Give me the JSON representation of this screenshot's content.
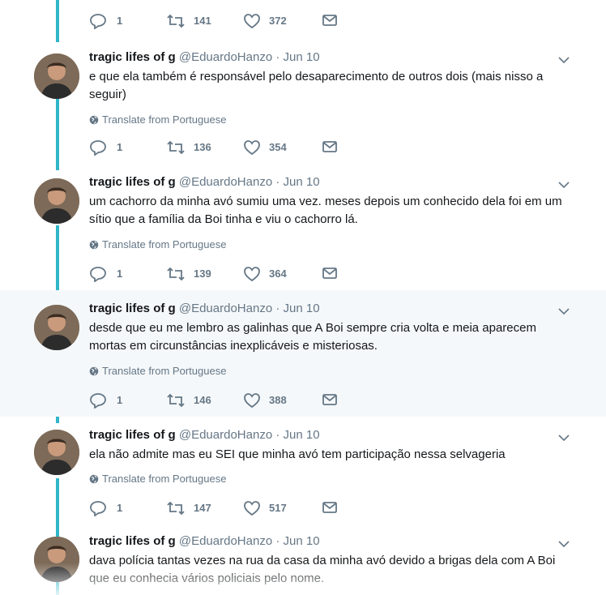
{
  "translate_label": "Translate from Portuguese",
  "accent_color": "#2fb6c9",
  "tweets": [
    {
      "replies": "1",
      "retweets": "141",
      "likes": "372"
    },
    {
      "name": "tragic lifes of g",
      "handle": "@EduardoHanzo",
      "sep": "·",
      "date": "Jun 10",
      "text": "e que ela também é responsável pelo desaparecimento de outros dois (mais nisso a seguir)",
      "replies": "1",
      "retweets": "136",
      "likes": "354"
    },
    {
      "name": "tragic lifes of g",
      "handle": "@EduardoHanzo",
      "sep": "·",
      "date": "Jun 10",
      "text": "um cachorro da minha avó sumiu uma vez. meses depois um conhecido dela foi em um sítio que a família da Boi tinha e viu o cachorro lá.",
      "replies": "1",
      "retweets": "139",
      "likes": "364"
    },
    {
      "name": "tragic lifes of g",
      "handle": "@EduardoHanzo",
      "sep": "·",
      "date": "Jun 10",
      "text": "desde que eu me lembro as galinhas que A Boi sempre cria volta e meia aparecem mortas em circunstâncias inexplicáveis e misteriosas.",
      "replies": "1",
      "retweets": "146",
      "likes": "388"
    },
    {
      "name": "tragic lifes of g",
      "handle": "@EduardoHanzo",
      "sep": "·",
      "date": "Jun 10",
      "text": "ela não admite mas eu SEI que minha avó tem participação nessa selvageria",
      "replies": "1",
      "retweets": "147",
      "likes": "517"
    },
    {
      "name": "tragic lifes of g",
      "handle": "@EduardoHanzo",
      "sep": "·",
      "date": "Jun 10",
      "text": "dava polícia tantas vezes na rua da casa da minha avó devido a brigas dela com A Boi que eu conhecia vários policiais pelo nome."
    }
  ]
}
